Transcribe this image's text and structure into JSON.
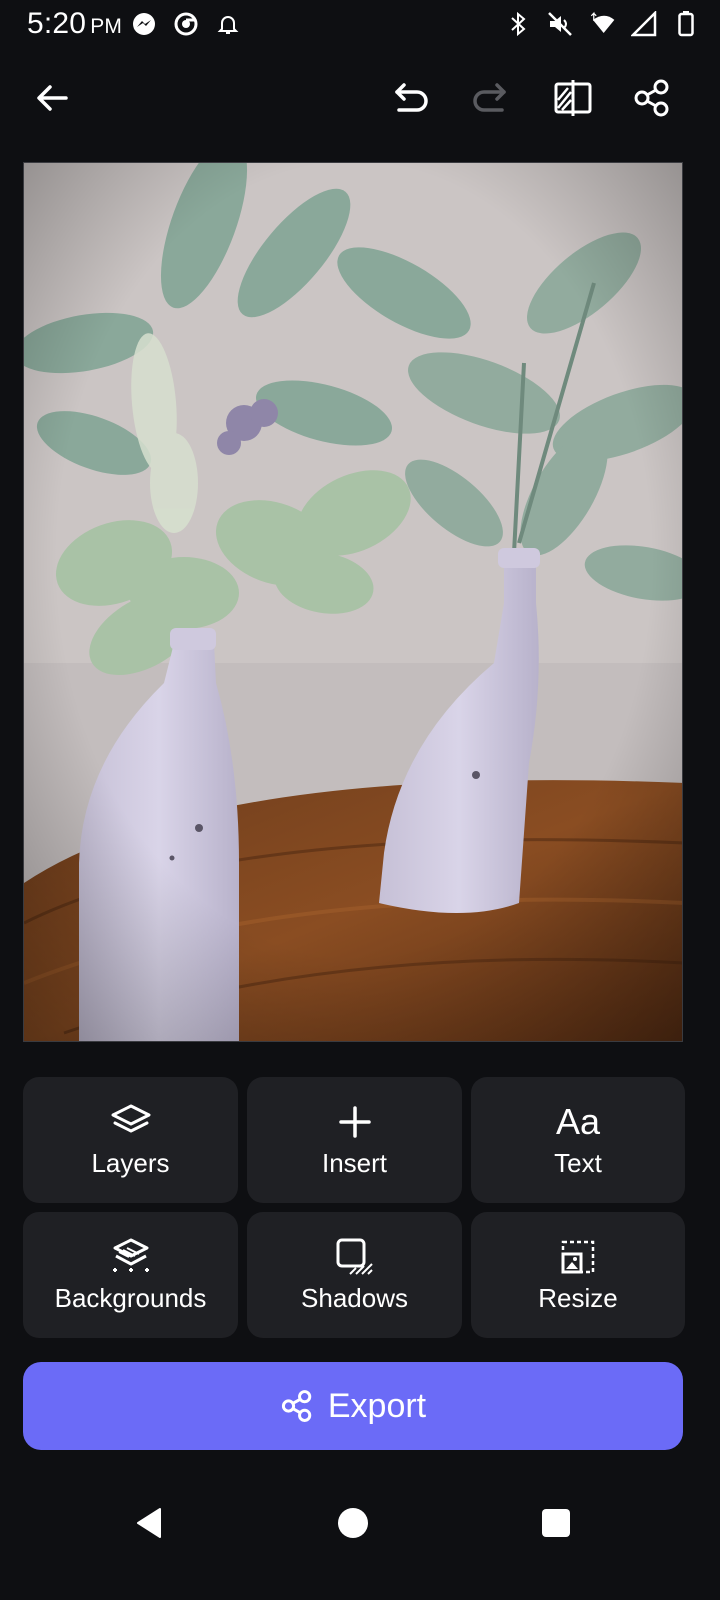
{
  "status_bar": {
    "time": "5:20",
    "ampm": "PM",
    "left_icons": [
      "messenger-icon",
      "chrome-icon",
      "bell-icon"
    ],
    "right_icons": [
      "bluetooth-icon",
      "mute-icon",
      "wifi-icon",
      "signal-icon",
      "battery-icon"
    ]
  },
  "toolbar": {
    "icons": [
      "back-arrow-icon",
      "undo-icon",
      "redo-icon",
      "compare-icon",
      "share-icon"
    ],
    "redo_enabled": false
  },
  "canvas": {
    "content": "photo-of-two-painted-bottles-with-greenery"
  },
  "tools": [
    {
      "label": "Layers",
      "icon": "layers-icon"
    },
    {
      "label": "Insert",
      "icon": "plus-icon"
    },
    {
      "label": "Text",
      "icon": "text-aa-icon",
      "icon_text": "Aa"
    },
    {
      "label": "Backgrounds",
      "icon": "backgrounds-icon"
    },
    {
      "label": "Shadows",
      "icon": "shadows-icon"
    },
    {
      "label": "Resize",
      "icon": "resize-icon"
    }
  ],
  "export": {
    "label": "Export",
    "icon": "share-icon",
    "color": "#6b6bf7"
  },
  "nav": {
    "icons": [
      "nav-back-icon",
      "nav-home-icon",
      "nav-recents-icon"
    ]
  }
}
